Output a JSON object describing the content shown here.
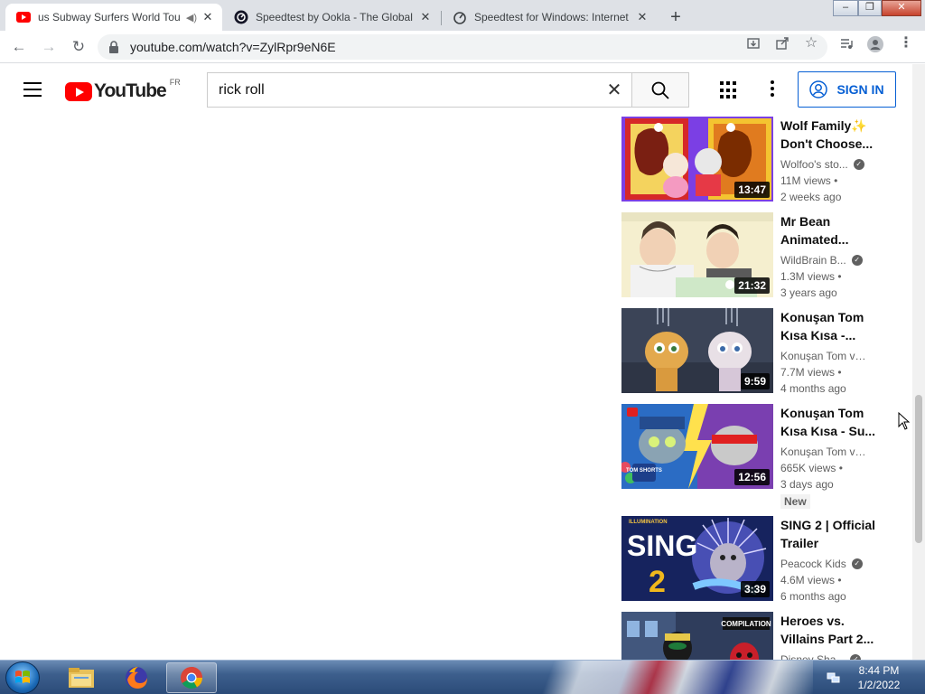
{
  "tabs": [
    {
      "title": "us Subway Surfers World Tou",
      "favicon": "youtube-icon",
      "active": true,
      "audio": true
    },
    {
      "title": "Speedtest by Ookla - The Global",
      "favicon": "ookla-icon",
      "active": false
    },
    {
      "title": "Speedtest for Windows: Internet",
      "favicon": "speedometer-icon",
      "active": false
    }
  ],
  "address_bar": {
    "url": "youtube.com/watch?v=ZylRpr9eN6E"
  },
  "youtube": {
    "region": "FR",
    "search_query": "rick roll",
    "sign_in_label": "SIGN IN"
  },
  "videos": [
    {
      "title": "Wolf Family✨ Don't Choose...",
      "channel": "Wolfoo's sto...",
      "verified": true,
      "views": "11M views •",
      "age": "2 weeks ago",
      "duration": "13:47",
      "badge": ""
    },
    {
      "title": "Mr Bean Animated...",
      "channel": "WildBrain B...",
      "verified": true,
      "views": "1.3M views •",
      "age": "3 years ago",
      "duration": "21:32",
      "badge": ""
    },
    {
      "title": "Konuşan Tom Kısa Kısa -...",
      "channel": "Konuşan Tom ve ...",
      "verified": false,
      "views": "7.7M views •",
      "age": "4 months ago",
      "duration": "9:59",
      "badge": ""
    },
    {
      "title": "Konuşan Tom Kısa Kısa - Su...",
      "channel": "Konuşan Tom ve ...",
      "verified": false,
      "views": "665K views •",
      "age": "3 days ago",
      "duration": "12:56",
      "badge": "New"
    },
    {
      "title": "SING 2 | Official Trailer",
      "channel": "Peacock Kids",
      "verified": true,
      "views": "4.6M views •",
      "age": "6 months ago",
      "duration": "3:39",
      "badge": ""
    },
    {
      "title": "Heroes vs. Villains Part 2...",
      "channel": "Disney Sha...",
      "verified": true,
      "views": "",
      "age": "",
      "duration": "",
      "badge": ""
    }
  ],
  "thumb_text": {
    "sing_title": "SING",
    "sing_number": "2",
    "illumination": "ILLUMINATION",
    "tom_shorts": "TOM SHORTS",
    "compilation": "COMPILATION"
  },
  "taskbar": {
    "time": "8:44 PM",
    "date": "1/2/2022",
    "apps": [
      "windows-explorer-icon",
      "firefox-icon",
      "chrome-icon"
    ]
  },
  "colors": {
    "youtube_red": "#ff0000",
    "link_blue": "#065fd4",
    "taskbar": "#2b4b78"
  }
}
